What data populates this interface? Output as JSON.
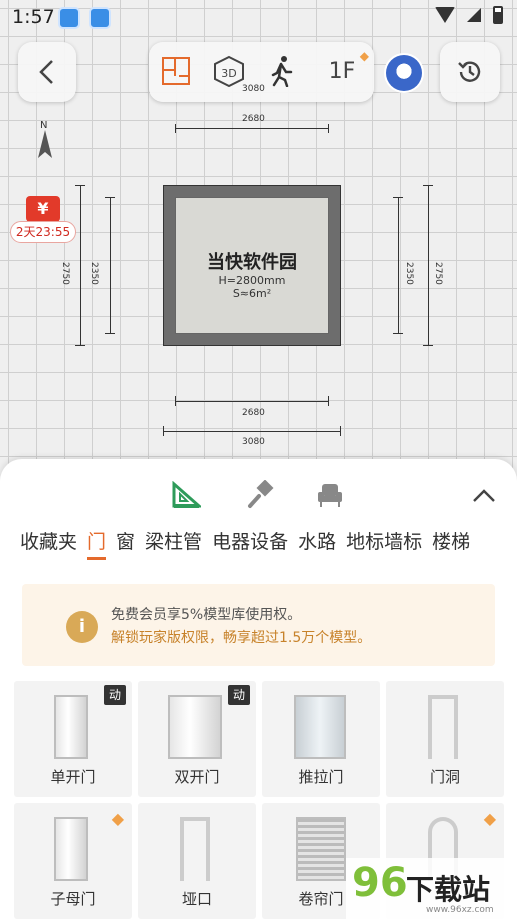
{
  "status_bar": {
    "time": "1:57"
  },
  "top_bar": {
    "floor": "1F"
  },
  "compass": {
    "north": "N"
  },
  "promo": {
    "symbol": "¥",
    "countdown": "2天23:55"
  },
  "plan": {
    "dims": {
      "top_outer": "3080",
      "top_inner": "2680",
      "bottom_inner": "2680",
      "bottom_outer": "3080",
      "left_outer": "2750",
      "left_inner": "2350",
      "right_inner": "2350",
      "right_outer": "2750"
    },
    "room": {
      "name": "当快软件园",
      "height": "H=2800mm",
      "area": "S≈6m²"
    }
  },
  "panel": {
    "categories": [
      "收藏夹",
      "门",
      "窗",
      "梁柱管",
      "电器设备",
      "水路",
      "地标墙标",
      "楼梯"
    ],
    "active_category": "门",
    "notice": {
      "icon": "i",
      "line1": "免费会员享5%模型库使用权。",
      "line2": "解锁玩家版权限，畅享超过1.5万个模型。"
    },
    "items": [
      {
        "label": "单开门",
        "badge": "动"
      },
      {
        "label": "双开门",
        "badge": "动"
      },
      {
        "label": "推拉门"
      },
      {
        "label": "门洞"
      },
      {
        "label": "子母门",
        "premium": true
      },
      {
        "label": "垭口"
      },
      {
        "label": "卷帘门"
      },
      {
        "label": "",
        "premium": true
      }
    ]
  },
  "watermark": {
    "brand": "96",
    "name": "下载站",
    "url": "www.96xz.com"
  }
}
